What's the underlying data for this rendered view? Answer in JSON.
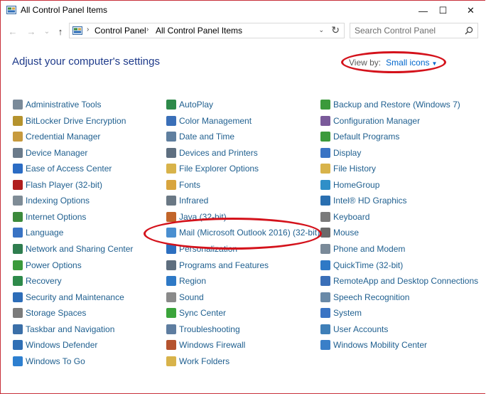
{
  "window": {
    "title": "All Control Panel Items",
    "controls": {
      "minimize": "—",
      "maximize": "☐",
      "close": "✕"
    }
  },
  "navigation": {
    "back": "←",
    "forward": "→",
    "recent": "⌄",
    "up": "↑",
    "breadcrumb": [
      "Control Panel",
      "All Control Panel Items"
    ],
    "search_placeholder": "Search Control Panel"
  },
  "header": {
    "title": "Adjust your computer's settings",
    "view_by_label": "View by:",
    "view_by_value": "Small icons"
  },
  "items": {
    "col1": [
      {
        "label": "Administrative Tools",
        "icon": "admin-tools-icon",
        "color": "#7a8a99"
      },
      {
        "label": "BitLocker Drive Encryption",
        "icon": "bitlocker-icon",
        "color": "#b5932e"
      },
      {
        "label": "Credential Manager",
        "icon": "credential-icon",
        "color": "#c79a3e"
      },
      {
        "label": "Device Manager",
        "icon": "device-manager-icon",
        "color": "#6b7b8b"
      },
      {
        "label": "Ease of Access Center",
        "icon": "ease-of-access-icon",
        "color": "#2b6cc4"
      },
      {
        "label": "Flash Player (32-bit)",
        "icon": "flash-icon",
        "color": "#b01e1e"
      },
      {
        "label": "Indexing Options",
        "icon": "indexing-icon",
        "color": "#7f8c96"
      },
      {
        "label": "Internet Options",
        "icon": "internet-options-icon",
        "color": "#3c8a3c"
      },
      {
        "label": "Language",
        "icon": "language-icon",
        "color": "#3973c4"
      },
      {
        "label": "Network and Sharing Center",
        "icon": "network-icon",
        "color": "#2f7d4f"
      },
      {
        "label": "Power Options",
        "icon": "power-icon",
        "color": "#3b9a3b"
      },
      {
        "label": "Recovery",
        "icon": "recovery-icon",
        "color": "#2e8a4a"
      },
      {
        "label": "Security and Maintenance",
        "icon": "security-flag-icon",
        "color": "#2d6db8"
      },
      {
        "label": "Storage Spaces",
        "icon": "storage-icon",
        "color": "#7b7b7b"
      },
      {
        "label": "Taskbar and Navigation",
        "icon": "taskbar-icon",
        "color": "#3b6fa8"
      },
      {
        "label": "Windows Defender",
        "icon": "defender-icon",
        "color": "#2f6fb5"
      },
      {
        "label": "Windows To Go",
        "icon": "windows-to-go-icon",
        "color": "#2d7fd0"
      }
    ],
    "col2": [
      {
        "label": "AutoPlay",
        "icon": "autoplay-icon",
        "color": "#2e8a4a"
      },
      {
        "label": "Color Management",
        "icon": "color-management-icon",
        "color": "#3a6fb8"
      },
      {
        "label": "Date and Time",
        "icon": "date-time-icon",
        "color": "#5f7f9f"
      },
      {
        "label": "Devices and Printers",
        "icon": "devices-printers-icon",
        "color": "#5e6f80"
      },
      {
        "label": "File Explorer Options",
        "icon": "folder-options-icon",
        "color": "#d8b34a"
      },
      {
        "label": "Fonts",
        "icon": "fonts-icon",
        "color": "#d8a53e"
      },
      {
        "label": "Infrared",
        "icon": "infrared-icon",
        "color": "#6a7884"
      },
      {
        "label": "Java (32-bit)",
        "icon": "java-icon",
        "color": "#c2652a"
      },
      {
        "label": "Mail (Microsoft Outlook 2016) (32-bit)",
        "icon": "mail-icon",
        "color": "#4a8fd0"
      },
      {
        "label": "Personalization",
        "icon": "personalization-icon",
        "color": "#2c6fc0"
      },
      {
        "label": "Programs and Features",
        "icon": "programs-icon",
        "color": "#5e6e7e"
      },
      {
        "label": "Region",
        "icon": "region-icon",
        "color": "#2e79c6"
      },
      {
        "label": "Sound",
        "icon": "sound-icon",
        "color": "#8a8a8a"
      },
      {
        "label": "Sync Center",
        "icon": "sync-icon",
        "color": "#3ba43b"
      },
      {
        "label": "Troubleshooting",
        "icon": "troubleshooting-icon",
        "color": "#5e7da0"
      },
      {
        "label": "Windows Firewall",
        "icon": "firewall-icon",
        "color": "#b5532e"
      },
      {
        "label": "Work Folders",
        "icon": "work-folders-icon",
        "color": "#d8b34a"
      }
    ],
    "col3": [
      {
        "label": "Backup and Restore (Windows 7)",
        "icon": "backup-restore-icon",
        "color": "#3b9a3b"
      },
      {
        "label": "Configuration Manager",
        "icon": "configuration-manager-icon",
        "color": "#7a5a9a"
      },
      {
        "label": "Default Programs",
        "icon": "default-programs-icon",
        "color": "#3b9a3b"
      },
      {
        "label": "Display",
        "icon": "display-icon",
        "color": "#3a74c4"
      },
      {
        "label": "File History",
        "icon": "file-history-icon",
        "color": "#d8b34a"
      },
      {
        "label": "HomeGroup",
        "icon": "homegroup-icon",
        "color": "#2f8fc8"
      },
      {
        "label": "Intel® HD Graphics",
        "icon": "intel-graphics-icon",
        "color": "#2a6fb0"
      },
      {
        "label": "Keyboard",
        "icon": "keyboard-icon",
        "color": "#7a7a7a"
      },
      {
        "label": "Mouse",
        "icon": "mouse-icon",
        "color": "#6a6a6a"
      },
      {
        "label": "Phone and Modem",
        "icon": "phone-modem-icon",
        "color": "#7a8a99"
      },
      {
        "label": "QuickTime (32-bit)",
        "icon": "quicktime-icon",
        "color": "#2e79c6"
      },
      {
        "label": "RemoteApp and Desktop Connections",
        "icon": "remoteapp-icon",
        "color": "#3a6fb8"
      },
      {
        "label": "Speech Recognition",
        "icon": "speech-icon",
        "color": "#6a8aa8"
      },
      {
        "label": "System",
        "icon": "system-icon",
        "color": "#3a74c4"
      },
      {
        "label": "User Accounts",
        "icon": "user-accounts-icon",
        "color": "#3f7fb8"
      },
      {
        "label": "Windows Mobility Center",
        "icon": "mobility-center-icon",
        "color": "#3a7fc8"
      }
    ]
  },
  "annotations": {
    "color": "#d4121b"
  }
}
